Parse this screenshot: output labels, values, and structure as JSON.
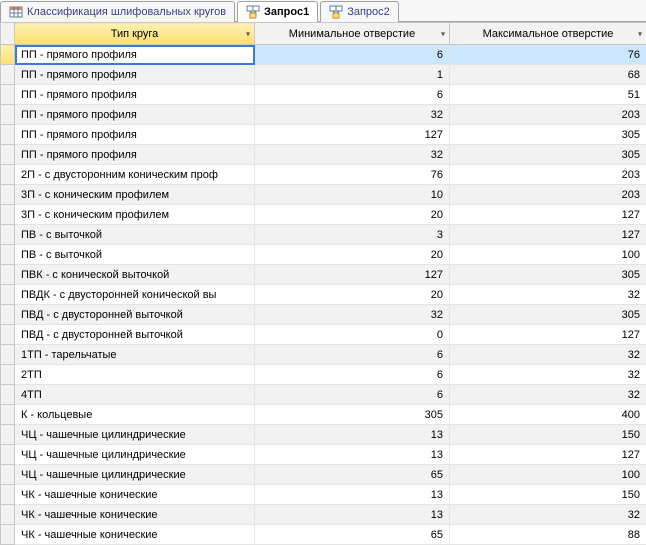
{
  "tabs": [
    {
      "label": "Классификация шлифовальных кругов",
      "icon": "table",
      "active": false
    },
    {
      "label": "Запрос1",
      "icon": "query",
      "active": true
    },
    {
      "label": "Запрос2",
      "icon": "query",
      "active": false
    }
  ],
  "columns": [
    {
      "label": "Тип круга",
      "active": true
    },
    {
      "label": "Минимальное отверстие",
      "active": false
    },
    {
      "label": "Максимальное отверстие",
      "active": false
    }
  ],
  "rows": [
    {
      "type": "ПП - прямого профиля",
      "min": 6,
      "max": 76,
      "selected": true,
      "editing": true
    },
    {
      "type": "ПП - прямого профиля",
      "min": 1,
      "max": 68
    },
    {
      "type": "ПП - прямого профиля",
      "min": 6,
      "max": 51
    },
    {
      "type": "ПП - прямого профиля",
      "min": 32,
      "max": 203
    },
    {
      "type": "ПП - прямого профиля",
      "min": 127,
      "max": 305
    },
    {
      "type": "ПП - прямого профиля",
      "min": 32,
      "max": 305
    },
    {
      "type": "2П - с двусторонним коническим проф",
      "min": 76,
      "max": 203
    },
    {
      "type": "3П - с коническим профилем",
      "min": 10,
      "max": 203
    },
    {
      "type": "3П - с коническим профилем",
      "min": 20,
      "max": 127
    },
    {
      "type": "ПВ - с выточкой",
      "min": 3,
      "max": 127
    },
    {
      "type": "ПВ - с выточкой",
      "min": 20,
      "max": 100
    },
    {
      "type": "ПВК - с конической выточкой",
      "min": 127,
      "max": 305
    },
    {
      "type": "ПВДК - с двусторонней конической вы",
      "min": 20,
      "max": 32
    },
    {
      "type": "ПВД - с двусторонней выточкой",
      "min": 32,
      "max": 305
    },
    {
      "type": "ПВД - с двусторонней выточкой",
      "min": 0,
      "max": 127
    },
    {
      "type": "1ТП - тарельчатые",
      "min": 6,
      "max": 32
    },
    {
      "type": "2ТП",
      "min": 6,
      "max": 32
    },
    {
      "type": "4ТП",
      "min": 6,
      "max": 32
    },
    {
      "type": "К - кольцевые",
      "min": 305,
      "max": 400
    },
    {
      "type": "ЧЦ - чашечные цилиндрические",
      "min": 13,
      "max": 150
    },
    {
      "type": "ЧЦ - чашечные цилиндрические",
      "min": 13,
      "max": 127
    },
    {
      "type": "ЧЦ - чашечные цилиндрические",
      "min": 65,
      "max": 100
    },
    {
      "type": "ЧК - чашечные конические",
      "min": 13,
      "max": 150
    },
    {
      "type": "ЧК - чашечные конические",
      "min": 13,
      "max": 32
    },
    {
      "type": "ЧК - чашечные конические",
      "min": 65,
      "max": 88
    }
  ]
}
